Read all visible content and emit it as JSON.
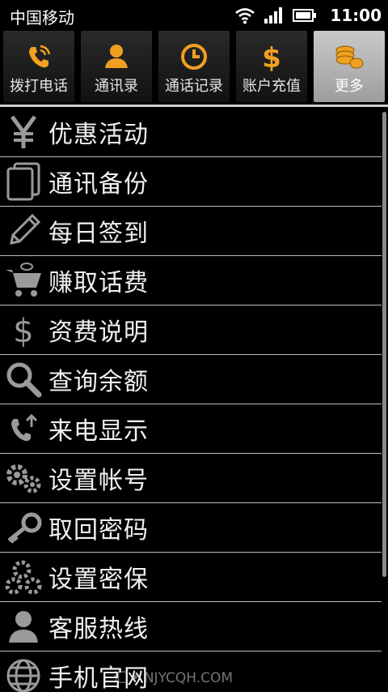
{
  "status_bar": {
    "carrier": "中国移动",
    "time": "11:00"
  },
  "tabs": [
    {
      "label": "拨打电话",
      "icon": "phone-icon",
      "active": false
    },
    {
      "label": "通讯录",
      "icon": "contact-icon",
      "active": false
    },
    {
      "label": "通话记录",
      "icon": "clock-icon",
      "active": false
    },
    {
      "label": "账户充值",
      "icon": "dollar-icon",
      "active": false
    },
    {
      "label": "更多",
      "icon": "coins-icon",
      "active": true
    }
  ],
  "menu": [
    {
      "label": "优惠活动",
      "icon": "yen-icon"
    },
    {
      "label": "通讯备份",
      "icon": "backup-icon"
    },
    {
      "label": "每日签到",
      "icon": "pencil-icon"
    },
    {
      "label": "赚取话费",
      "icon": "cart-icon"
    },
    {
      "label": "资费说明",
      "icon": "dollar-icon"
    },
    {
      "label": "查询余额",
      "icon": "search-icon"
    },
    {
      "label": "来电显示",
      "icon": "incoming-call-icon"
    },
    {
      "label": "设置帐号",
      "icon": "gears-icon"
    },
    {
      "label": "取回密码",
      "icon": "key-icon"
    },
    {
      "label": "设置密保",
      "icon": "settings-icon"
    },
    {
      "label": "客服热线",
      "icon": "user-icon"
    },
    {
      "label": "手机官网",
      "icon": "globe-icon"
    }
  ],
  "watermark": "汇 • NJYCQH.COM",
  "colors": {
    "accent_orange": "#f0a020",
    "active_tab": "#b8b8b8",
    "divider": "#bdbdbd",
    "icon_gray": "#9a9a9a"
  }
}
